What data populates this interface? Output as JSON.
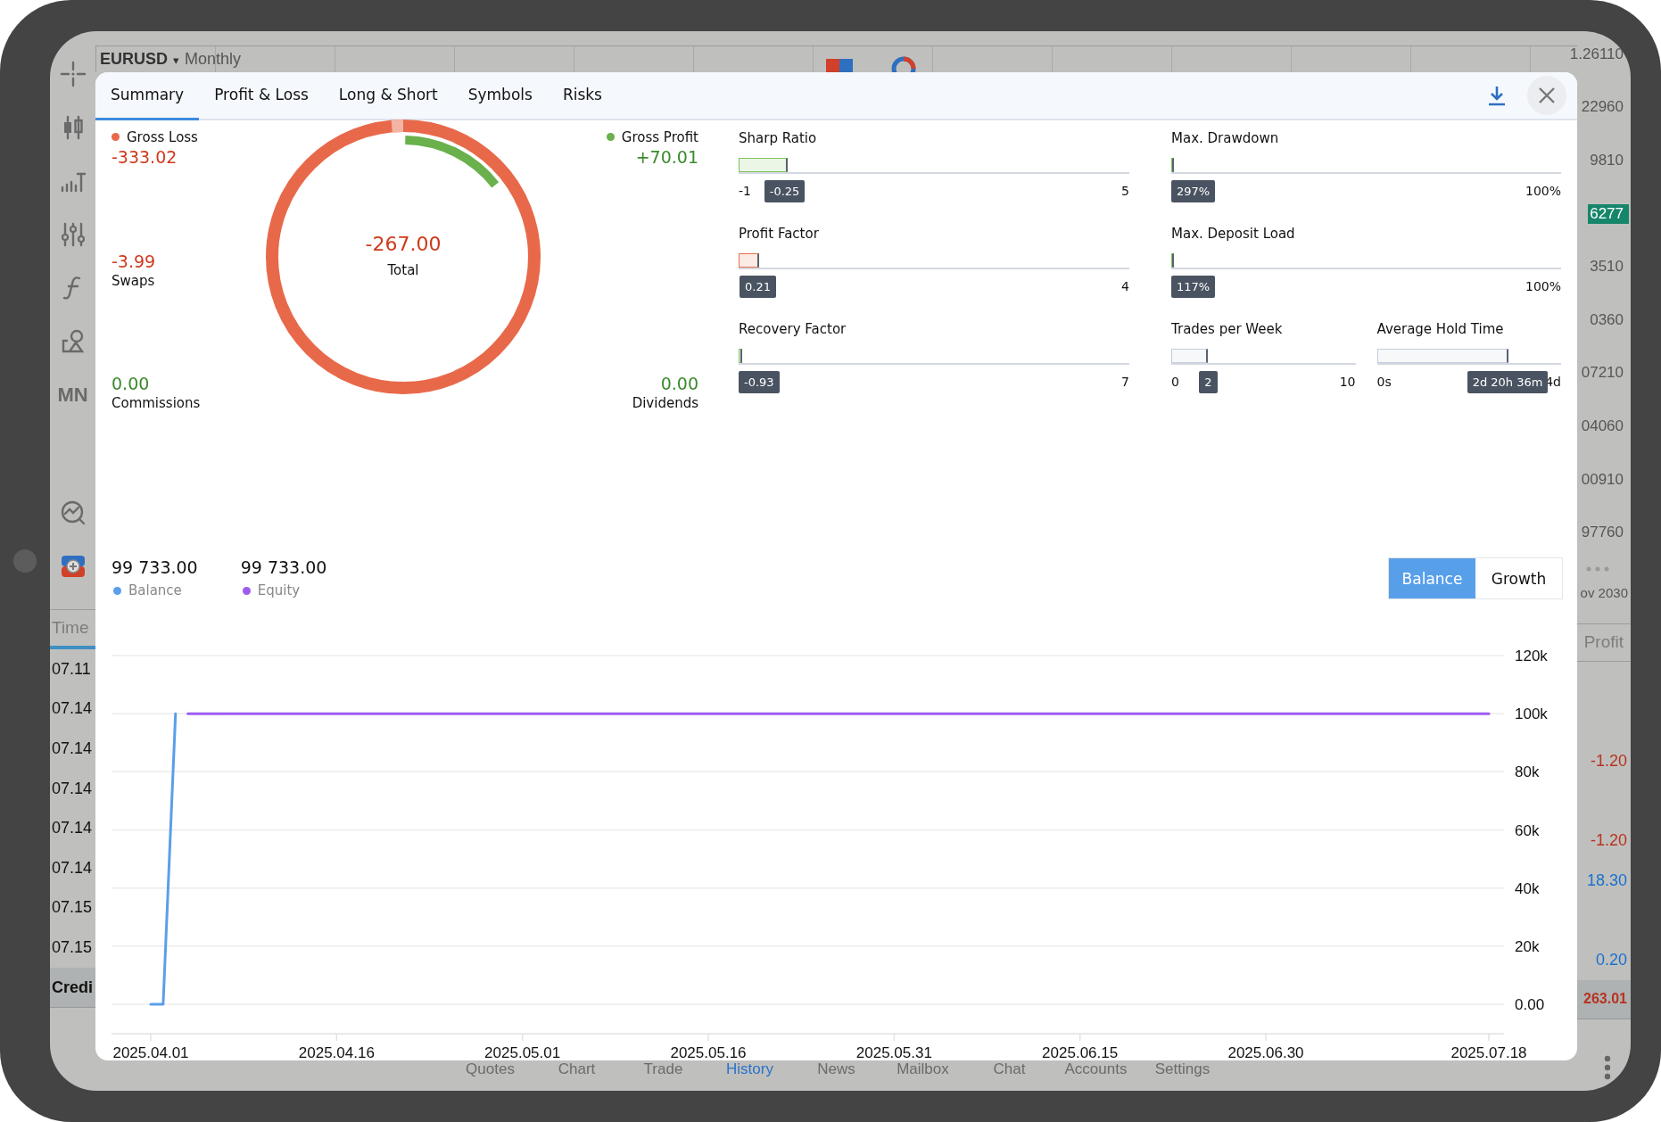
{
  "chart_header": {
    "symbol": "EURUSD",
    "caret": "▾",
    "timeframe": "Monthly"
  },
  "toolbar": {
    "period_label": "MN"
  },
  "price_axis": [
    {
      "label": "1.26110",
      "current": false
    },
    {
      "label": "22960",
      "current": false
    },
    {
      "label": "9810",
      "current": false
    },
    {
      "label": "6277",
      "current": true
    },
    {
      "label": "3510",
      "current": false
    },
    {
      "label": "0360",
      "current": false
    },
    {
      "label": "07210",
      "current": false
    },
    {
      "label": "04060",
      "current": false
    },
    {
      "label": "00910",
      "current": false
    },
    {
      "label": "97760",
      "current": false
    }
  ],
  "axis_date": "ov 2030",
  "history_table": {
    "columns": [
      "Time",
      "Profit"
    ],
    "rows": [
      {
        "time": "07.11"
      },
      {
        "time": "07.14"
      },
      {
        "time": "07.14",
        "profit": "-1.20",
        "color": "#b8321f"
      },
      {
        "time": "07.14"
      },
      {
        "time": "07.14",
        "profit": "-1.20",
        "color": "#b8321f"
      },
      {
        "time": "07.14",
        "profit": "18.30",
        "color": "#1b6fcf"
      },
      {
        "time": "07.15"
      },
      {
        "time": "07.15",
        "profit": "0.20",
        "color": "#1b6fcf"
      }
    ],
    "total": {
      "label": "Credi",
      "profit": "263.01",
      "color": "#b8321f"
    }
  },
  "report": {
    "tabs": [
      {
        "label": "Summary",
        "selected": true
      },
      {
        "label": "Profit & Loss",
        "selected": false
      },
      {
        "label": "Long & Short",
        "selected": false
      },
      {
        "label": "Symbols",
        "selected": false
      },
      {
        "label": "Risks",
        "selected": false
      }
    ],
    "summary": {
      "left": [
        {
          "label": "Gross Loss",
          "value": "-333.02",
          "color": "#cf3a1c",
          "marker": {
            "color": "#e8694a"
          }
        },
        {
          "label": "Swaps",
          "value": "-3.99",
          "color": "#cf3a1c"
        },
        {
          "label": "Commissions",
          "value": "0.00",
          "color": "#3b8a2d"
        }
      ],
      "right": [
        {
          "label": "Gross Profit",
          "value": "+70.01",
          "color": "#3b8a2d",
          "marker": {
            "color": "#6ab04c"
          }
        },
        {
          "label": "Dividends",
          "value": "0.00",
          "color": "#3b8a2d"
        }
      ],
      "total": {
        "value": "-267.00",
        "label": "Total",
        "color": "#cf3a1c"
      }
    },
    "metric_columns": [
      {
        "rows": [
          [
            {
              "label": "Sharp Ratio",
              "min": "-1",
              "max": "5",
              "value": "-0.25",
              "level": 0.125,
              "color": "#7cc35a"
            }
          ],
          [
            {
              "label": "Profit Factor",
              "max": "4",
              "value": "0.21",
              "level": 0.0525,
              "color": "#e8704f"
            }
          ],
          [
            {
              "label": "Recovery Factor",
              "max": "7",
              "value": "-0.93",
              "level": 0.008,
              "color": "#7cc35a"
            }
          ]
        ]
      },
      {
        "rows": [
          [
            {
              "label": "Max. Drawdown",
              "max": "100%",
              "value": "297%",
              "level": 0.005,
              "color": "#7cc35a"
            }
          ],
          [
            {
              "label": "Max. Deposit Load",
              "max": "100%",
              "value": "117%",
              "level": 0.005,
              "color": "#7cc35a"
            }
          ],
          [
            {
              "label": "Trades per Week",
              "min": "0",
              "max": "10",
              "value": "2",
              "level": 0.2,
              "color": "#c3cddd"
            },
            {
              "label": "Average Hold Time",
              "min": "0s",
              "max": "4d",
              "value": "2d 20h 36m",
              "level": 0.7125,
              "color": "#c3cddd"
            }
          ]
        ]
      }
    ],
    "balance": {
      "legend": [
        {
          "value": "99 733.00"
        },
        {
          "value": "99 733.00"
        }
      ],
      "modes": [
        {
          "label": "Balance",
          "selected": true
        },
        {
          "label": "Growth",
          "selected": false
        }
      ],
      "chart_data": {
        "type": "line",
        "categories": [
          "2025.04.01",
          null,
          null,
          null,
          null,
          null,
          null,
          null,
          null,
          null,
          null,
          null,
          null,
          null,
          null,
          "2025.04.16",
          null,
          null,
          null,
          null,
          null,
          null,
          null,
          null,
          null,
          null,
          null,
          null,
          null,
          null,
          "2025.05.01",
          null,
          null,
          null,
          null,
          null,
          null,
          null,
          null,
          null,
          null,
          null,
          null,
          null,
          null,
          "2025.05.16",
          null,
          null,
          null,
          null,
          null,
          null,
          null,
          null,
          null,
          null,
          null,
          null,
          null,
          null,
          "2025.05.31",
          null,
          null,
          null,
          null,
          null,
          null,
          null,
          null,
          null,
          null,
          null,
          null,
          null,
          null,
          "2025.06.15",
          null,
          null,
          null,
          null,
          null,
          null,
          null,
          null,
          null,
          null,
          null,
          null,
          null,
          null,
          "2025.06.30",
          null,
          null,
          null,
          null,
          null,
          null,
          null,
          null,
          null,
          null,
          null,
          null,
          null,
          null,
          null,
          null,
          null,
          "2025.07.18"
        ],
        "grid": true,
        "series": [
          {
            "name": "Balance",
            "color": "#5b9ee9",
            "values": [
              0,
              0,
              100000,
              null,
              null,
              null,
              null,
              null,
              null,
              null,
              null,
              null,
              null,
              null,
              null,
              null,
              null,
              null,
              null,
              null,
              null,
              null,
              null,
              null,
              null,
              null,
              null,
              null,
              null,
              null,
              null,
              null,
              null,
              null,
              null,
              null,
              null,
              null,
              null,
              null,
              null,
              null,
              null,
              null,
              null,
              null,
              null,
              null,
              null,
              null,
              null,
              null,
              null,
              null,
              null,
              null,
              null,
              null,
              null,
              null,
              null,
              null,
              null,
              null,
              null,
              null,
              null,
              null,
              null,
              null,
              null,
              null,
              null,
              null,
              null,
              null,
              null,
              null,
              null,
              null,
              null,
              null,
              null,
              null,
              null,
              null,
              null,
              null,
              null,
              null,
              null,
              null,
              null,
              null,
              null,
              null,
              null,
              null,
              null,
              null,
              null,
              null,
              null,
              null,
              null,
              null,
              null,
              null,
              null
            ]
          },
          {
            "name": "Equity",
            "color": "#9d5cf0",
            "values": [
              null,
              null,
              null,
              100000,
              100000,
              100000,
              100000,
              100000,
              100000,
              100000,
              100000,
              100000,
              100000,
              100000,
              100000,
              100000,
              100000,
              100000,
              100000,
              100000,
              100000,
              100000,
              100000,
              100000,
              100000,
              100000,
              100000,
              100000,
              100000,
              100000,
              100000,
              100000,
              100000,
              100000,
              100000,
              100000,
              100000,
              100000,
              100000,
              100000,
              100000,
              100000,
              100000,
              100000,
              100000,
              100000,
              100000,
              100000,
              100000,
              100000,
              100000,
              100000,
              100000,
              100000,
              100000,
              100000,
              100000,
              100000,
              100000,
              100000,
              100000,
              100000,
              100000,
              100000,
              100000,
              100000,
              100000,
              100000,
              100000,
              100000,
              100000,
              100000,
              100000,
              100000,
              100000,
              100000,
              100000,
              100000,
              100000,
              100000,
              100000,
              100000,
              100000,
              100000,
              100000,
              100000,
              100000,
              100000,
              100000,
              100000,
              100000,
              100000,
              100000,
              100000,
              100000,
              100000,
              100000,
              100000,
              100000,
              100000,
              100000,
              100000,
              100000,
              100000,
              100000,
              100000,
              100000,
              100000,
              100000
            ]
          }
        ],
        "ylim": [
          0,
          120000
        ],
        "yticks": [
          {
            "value": 0,
            "label": "0.00"
          },
          {
            "value": 20000,
            "label": "20k"
          },
          {
            "value": 40000,
            "label": "40k"
          },
          {
            "value": 60000,
            "label": "60k"
          },
          {
            "value": 80000,
            "label": "80k"
          },
          {
            "value": 100000,
            "label": "100k"
          },
          {
            "value": 120000,
            "label": "120k"
          }
        ]
      }
    }
  },
  "bottom_nav": [
    {
      "label": "Quotes",
      "selected": false
    },
    {
      "label": "Chart",
      "selected": false
    },
    {
      "label": "Trade",
      "selected": false
    },
    {
      "label": "History",
      "selected": true
    },
    {
      "label": "News",
      "selected": false
    },
    {
      "label": "Mailbox",
      "selected": false
    },
    {
      "label": "Chat",
      "selected": false
    },
    {
      "label": "Accounts",
      "selected": false
    },
    {
      "label": "Settings",
      "selected": false
    }
  ]
}
